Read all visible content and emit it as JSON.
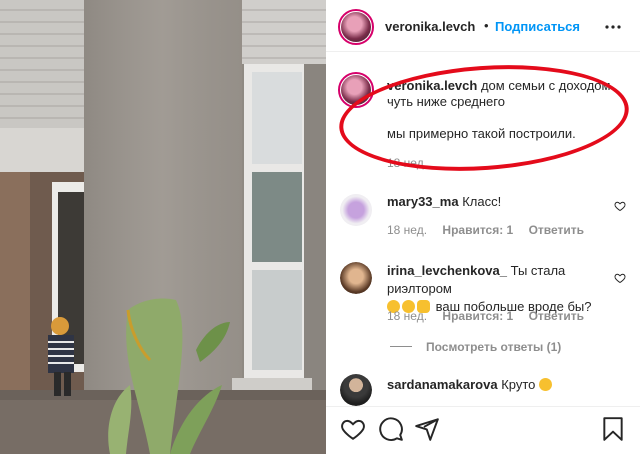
{
  "post_author": {
    "username": "veronika.levch",
    "separator": "•",
    "follow_label": "Подписаться",
    "more_icon": "more-horizontal-icon"
  },
  "caption": {
    "username": "veronika.levch",
    "line1": "дом семьи с доходом",
    "line2": "чуть ниже среднего",
    "line3": "мы примерно такой построили.",
    "time": "18 нед."
  },
  "comments": [
    {
      "username": "mary33_ma",
      "text": "Класс!",
      "time": "18 нед.",
      "likes": "Нравится: 1",
      "reply": "Ответить"
    },
    {
      "username": "irina_levchenkova_",
      "text": "Ты стала риэлтором",
      "text2": "ваш побольше вроде бы?",
      "time": "18 нед.",
      "likes": "Нравится: 1",
      "reply": "Ответить",
      "view_replies": "Посмотреть ответы (1)"
    },
    {
      "username": "sardanamakarova",
      "text": "Круто"
    }
  ],
  "actions": {
    "like_icon": "heart-icon",
    "comment_icon": "comment-icon",
    "share_icon": "share-icon",
    "save_icon": "bookmark-icon"
  },
  "colors": {
    "accent": "#0095f6",
    "highlight": "#e40b1b",
    "text": "#262626",
    "muted": "#8e8e8e"
  }
}
